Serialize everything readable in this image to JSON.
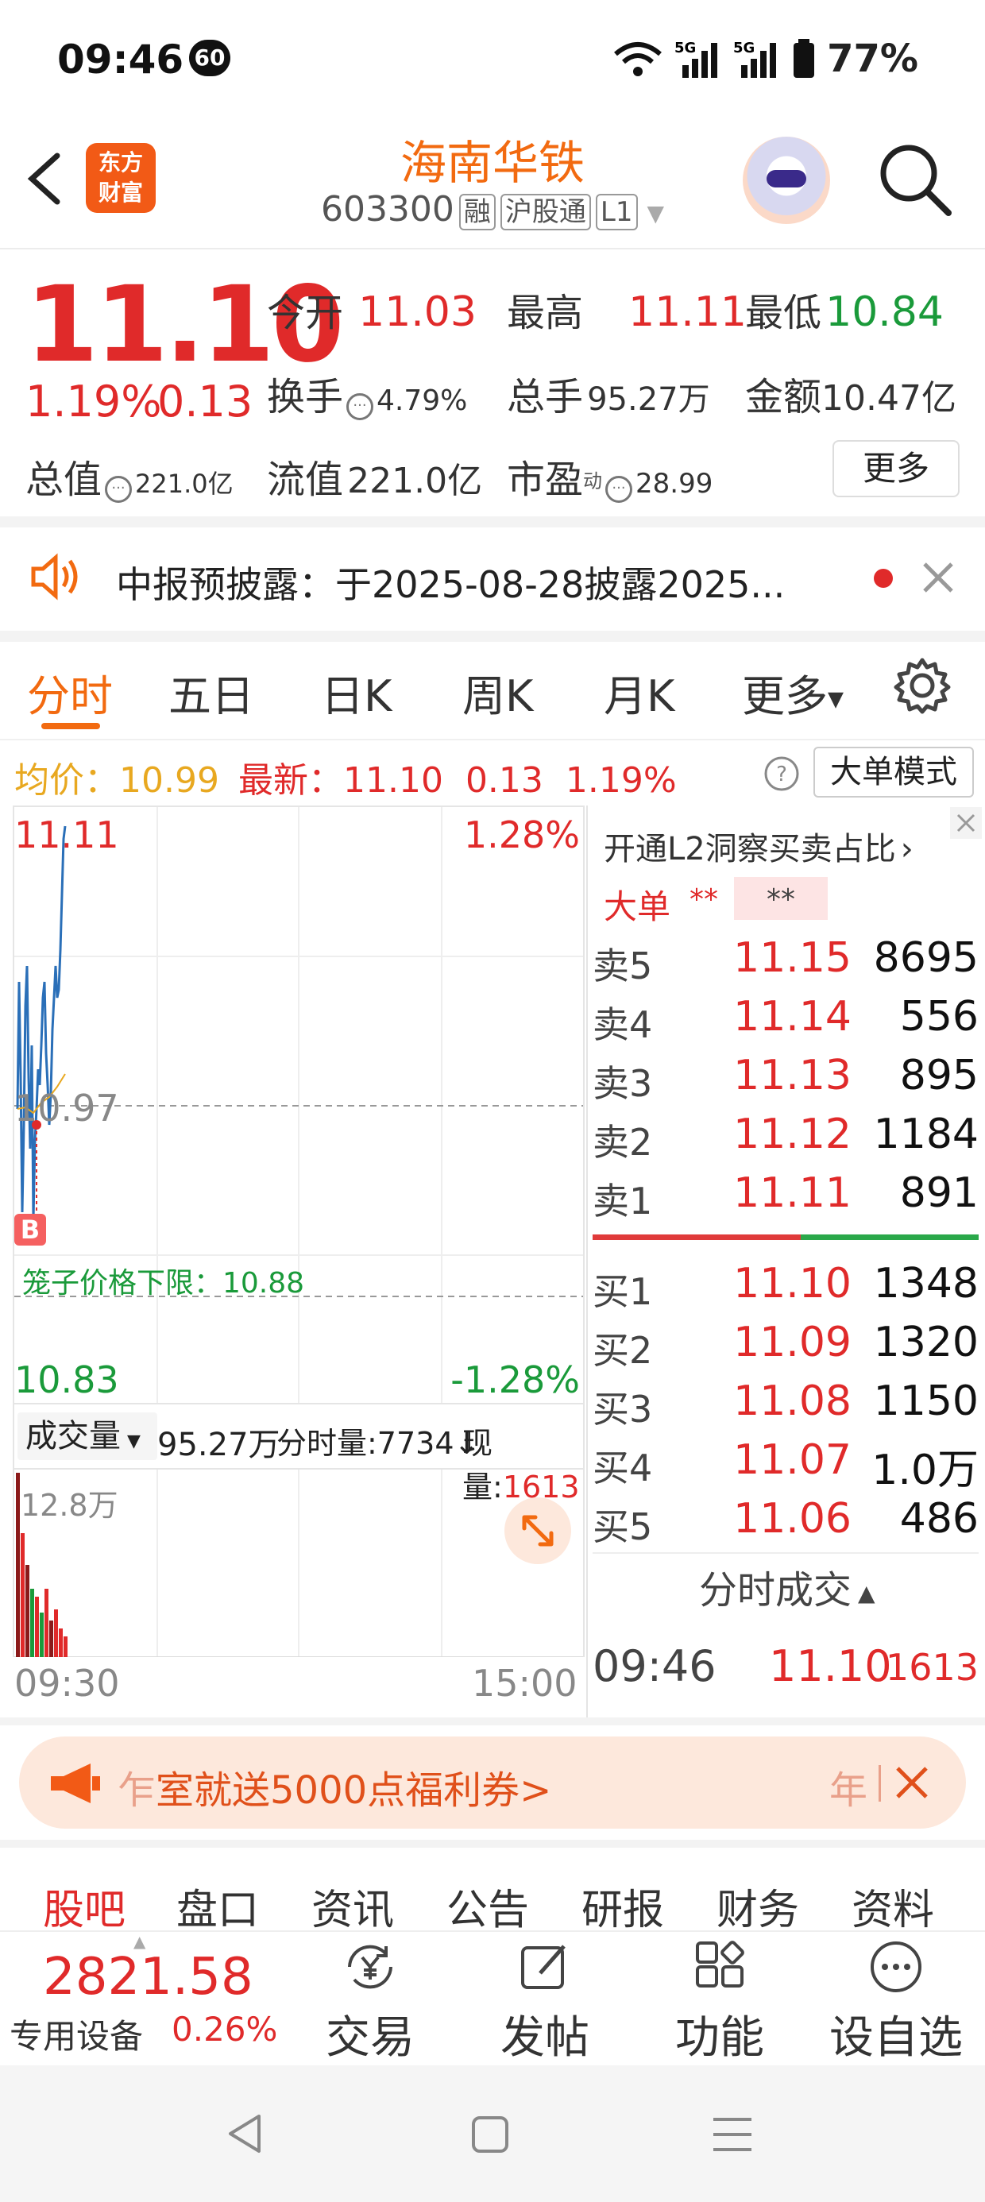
{
  "status_bar": {
    "time": "09:46",
    "badge": "60",
    "right": "5G 5G 77%"
  },
  "header": {
    "back_icon": "chevron-left-icon",
    "logo_line1": "东方",
    "logo_line2": "财富",
    "stock_name": "海南华铁",
    "stock_code": "603300",
    "tags": [
      "融",
      "沪股通",
      "L1"
    ],
    "search_icon": "search-icon"
  },
  "quote": {
    "price": "11.10",
    "change_pct": "1.19%",
    "change_abs": "0.13",
    "open_label": "今开",
    "open": "11.03",
    "high_label": "最高",
    "high": "11.11",
    "low_label": "最低",
    "low": "10.84",
    "turnover_label": "换手",
    "turnover": "4.79%",
    "volume_label": "总手",
    "volume": "95.27万",
    "amount_label": "金额",
    "amount": "10.47亿",
    "mktcap_label": "总值",
    "mktcap": "221.0亿",
    "float_label": "流值",
    "float": "221.0亿",
    "pe_label": "市盈",
    "pe_sup": "动",
    "pe": "28.99",
    "more_label": "更多"
  },
  "notice": {
    "text": "中报预披露：于2025-08-28披露2025..."
  },
  "chart_tabs": {
    "items": [
      "分时",
      "五日",
      "日K",
      "周K",
      "月K",
      "更多"
    ],
    "active": "分时"
  },
  "info_line": {
    "avg_label": "均价：",
    "avg": "10.99",
    "latest_label": "最新：",
    "latest": "11.10",
    "chg": "0.13",
    "pct": "1.19%",
    "big_order_btn": "大单模式"
  },
  "chart_labels": {
    "top_price": "11.11",
    "top_pct": "1.28%",
    "mid_price": "10.97",
    "bottom_price": "10.83",
    "bottom_pct": "-1.28%",
    "cage_label": "笼子价格下限：10.88",
    "b_marker": "B",
    "vol_selector": "成交量",
    "vol_total": "95.27万",
    "vol_min": "分时量:7734↓",
    "vol_now_label": "现量:",
    "vol_now": "1613",
    "vol_max": "12.8万",
    "time_start": "09:30",
    "time_end": "15:00"
  },
  "order_book": {
    "l2_link": "开通L2洞察买卖占比",
    "big_label": "大单",
    "big_val1": "**",
    "big_val2": "**",
    "asks": [
      {
        "label": "卖5",
        "price": "11.15",
        "vol": "8695"
      },
      {
        "label": "卖4",
        "price": "11.14",
        "vol": "556"
      },
      {
        "label": "卖3",
        "price": "11.13",
        "vol": "895"
      },
      {
        "label": "卖2",
        "price": "11.12",
        "vol": "1184"
      },
      {
        "label": "卖1",
        "price": "11.11",
        "vol": "891"
      }
    ],
    "bids": [
      {
        "label": "买1",
        "price": "11.10",
        "vol": "1348"
      },
      {
        "label": "买2",
        "price": "11.09",
        "vol": "1320"
      },
      {
        "label": "买3",
        "price": "11.08",
        "vol": "1150"
      },
      {
        "label": "买4",
        "price": "11.07",
        "vol": "1.0万"
      },
      {
        "label": "买5",
        "price": "11.06",
        "vol": "486"
      }
    ],
    "ticks_label": "分时成交",
    "tick": {
      "time": "09:46",
      "price": "11.10",
      "vol": "1613"
    }
  },
  "promo": {
    "text_left": "乍",
    "text": "室就送5000点福利券>",
    "text_right": "年"
  },
  "sub_tabs": {
    "items": [
      "股吧",
      "盘口",
      "资讯",
      "公告",
      "研报",
      "财务",
      "资料"
    ],
    "active": "股吧"
  },
  "bottom_nav": {
    "index_value": "2821.58",
    "index_label": "专用设备",
    "index_pct": "0.26%",
    "items": [
      {
        "label": "交易",
        "icon": "yen-exchange-icon"
      },
      {
        "label": "发帖",
        "icon": "edit-icon"
      },
      {
        "label": "功能",
        "icon": "grid-icon"
      },
      {
        "label": "设自选",
        "icon": "more-dots-icon"
      }
    ]
  },
  "colors": {
    "up": "#e02a2a",
    "down": "#1a9a3a",
    "accent": "#f26a10",
    "line": "#2a6fb8"
  }
}
